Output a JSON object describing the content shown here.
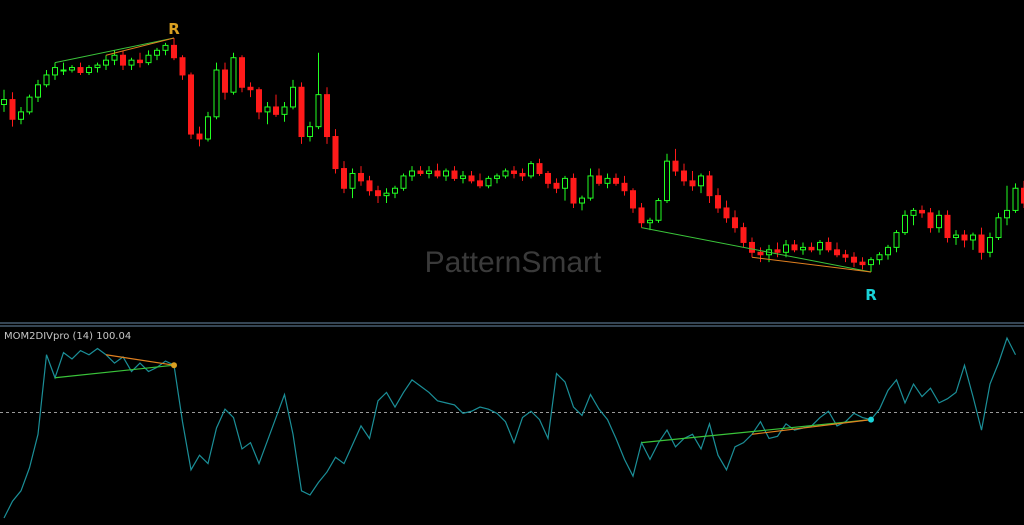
{
  "watermark": "PatternSmart",
  "indicator": {
    "name": "MOM2DIVpro (14) 100.04"
  },
  "markers": [
    {
      "label": "R",
      "color": "#d9a021"
    },
    {
      "label": "R",
      "color": "#19d3d8"
    }
  ],
  "colors": {
    "bull": "#22ff22",
    "bear": "#ff1a1a",
    "momentum": "#1b8f98",
    "divergence_green": "#3ac43a",
    "divergence_orange": "#e08020",
    "separator": "#6a8aa8",
    "zero_line": "#9a9a9a"
  },
  "chart_data": [
    {
      "type": "candlestick",
      "title": "",
      "series": [
        {
          "values": [
            [
              101.2,
              101.8,
              100.9,
              101.4
            ],
            [
              101.4,
              101.7,
              100.3,
              100.6
            ],
            [
              100.6,
              101.1,
              100.4,
              100.9
            ],
            [
              100.9,
              101.6,
              100.8,
              101.5
            ],
            [
              101.5,
              102.2,
              101.3,
              102.0
            ],
            [
              102.0,
              102.6,
              101.9,
              102.4
            ],
            [
              102.4,
              102.9,
              102.2,
              102.7
            ],
            [
              102.6,
              102.9,
              102.4,
              102.6
            ],
            [
              102.6,
              102.8,
              102.5,
              102.7
            ],
            [
              102.7,
              102.9,
              102.4,
              102.5
            ],
            [
              102.5,
              102.8,
              102.4,
              102.7
            ],
            [
              102.7,
              102.9,
              102.5,
              102.8
            ],
            [
              102.8,
              103.2,
              102.6,
              103.0
            ],
            [
              103.0,
              103.4,
              102.8,
              103.2
            ],
            [
              103.2,
              103.4,
              102.6,
              102.8
            ],
            [
              102.8,
              103.1,
              102.6,
              103.0
            ],
            [
              103.0,
              103.3,
              102.7,
              102.9
            ],
            [
              102.9,
              103.4,
              102.8,
              103.2
            ],
            [
              103.2,
              103.5,
              103.0,
              103.4
            ],
            [
              103.4,
              103.7,
              103.2,
              103.6
            ],
            [
              103.6,
              103.9,
              103.0,
              103.1
            ],
            [
              103.1,
              103.2,
              102.2,
              102.4
            ],
            [
              102.4,
              102.5,
              99.8,
              100.0
            ],
            [
              100.0,
              100.3,
              99.5,
              99.8
            ],
            [
              99.8,
              100.9,
              99.7,
              100.7
            ],
            [
              100.7,
              102.9,
              100.6,
              102.6
            ],
            [
              102.6,
              102.9,
              101.4,
              101.7
            ],
            [
              101.7,
              103.3,
              101.6,
              103.1
            ],
            [
              103.1,
              103.2,
              101.7,
              101.9
            ],
            [
              101.9,
              102.1,
              101.5,
              101.8
            ],
            [
              101.8,
              101.9,
              100.6,
              100.9
            ],
            [
              100.9,
              101.3,
              100.4,
              101.1
            ],
            [
              101.1,
              101.6,
              100.7,
              100.8
            ],
            [
              100.8,
              101.3,
              100.5,
              101.1
            ],
            [
              101.1,
              102.2,
              101.0,
              101.9
            ],
            [
              101.9,
              102.1,
              99.6,
              99.9
            ],
            [
              99.9,
              100.5,
              99.7,
              100.3
            ],
            [
              100.3,
              103.3,
              100.2,
              101.6
            ],
            [
              101.6,
              101.9,
              99.6,
              99.9
            ],
            [
              99.9,
              100.2,
              98.4,
              98.6
            ],
            [
              98.6,
              98.9,
              97.6,
              97.8
            ],
            [
              97.8,
              98.6,
              97.4,
              98.4
            ],
            [
              98.4,
              98.7,
              97.9,
              98.1
            ],
            [
              98.1,
              98.3,
              97.5,
              97.7
            ],
            [
              97.7,
              97.9,
              97.2,
              97.5
            ],
            [
              97.5,
              97.8,
              97.2,
              97.6
            ],
            [
              97.6,
              97.9,
              97.4,
              97.8
            ],
            [
              97.8,
              98.4,
              97.7,
              98.3
            ],
            [
              98.3,
              98.7,
              98.1,
              98.5
            ],
            [
              98.5,
              98.7,
              98.3,
              98.4
            ],
            [
              98.4,
              98.7,
              98.2,
              98.5
            ],
            [
              98.5,
              98.8,
              98.2,
              98.3
            ],
            [
              98.3,
              98.6,
              98.1,
              98.5
            ],
            [
              98.5,
              98.7,
              98.1,
              98.2
            ],
            [
              98.2,
              98.5,
              98.0,
              98.3
            ],
            [
              98.3,
              98.5,
              98.0,
              98.1
            ],
            [
              98.1,
              98.4,
              97.8,
              97.9
            ],
            [
              97.9,
              98.3,
              97.8,
              98.2
            ],
            [
              98.2,
              98.4,
              98.0,
              98.3
            ],
            [
              98.3,
              98.6,
              98.2,
              98.5
            ],
            [
              98.5,
              98.7,
              98.2,
              98.4
            ],
            [
              98.4,
              98.6,
              98.1,
              98.3
            ],
            [
              98.3,
              98.9,
              98.2,
              98.8
            ],
            [
              98.8,
              99.0,
              98.3,
              98.4
            ],
            [
              98.4,
              98.5,
              97.8,
              98.0
            ],
            [
              98.0,
              98.2,
              97.6,
              97.8
            ],
            [
              97.8,
              98.3,
              97.3,
              98.2
            ],
            [
              98.2,
              98.4,
              97.0,
              97.2
            ],
            [
              97.2,
              97.5,
              96.9,
              97.4
            ],
            [
              97.4,
              98.6,
              97.3,
              98.3
            ],
            [
              98.3,
              98.6,
              97.9,
              98.0
            ],
            [
              98.0,
              98.4,
              97.8,
              98.2
            ],
            [
              98.2,
              98.4,
              97.9,
              98.0
            ],
            [
              98.0,
              98.3,
              97.5,
              97.7
            ],
            [
              97.7,
              97.8,
              96.8,
              97.0
            ],
            [
              97.0,
              97.2,
              96.2,
              96.4
            ],
            [
              96.4,
              96.6,
              96.1,
              96.5
            ],
            [
              96.5,
              97.4,
              96.4,
              97.3
            ],
            [
              97.3,
              99.2,
              97.2,
              98.9
            ],
            [
              98.9,
              99.4,
              98.3,
              98.5
            ],
            [
              98.5,
              98.8,
              97.9,
              98.1
            ],
            [
              98.1,
              98.5,
              97.7,
              97.9
            ],
            [
              97.9,
              98.4,
              97.6,
              98.3
            ],
            [
              98.3,
              98.5,
              97.2,
              97.5
            ],
            [
              97.5,
              97.8,
              96.8,
              97.0
            ],
            [
              97.0,
              97.3,
              96.4,
              96.6
            ],
            [
              96.6,
              96.9,
              96.0,
              96.2
            ],
            [
              96.2,
              96.4,
              95.4,
              95.6
            ],
            [
              95.6,
              95.8,
              95.0,
              95.2
            ],
            [
              95.2,
              95.4,
              94.8,
              95.1
            ],
            [
              95.1,
              95.5,
              94.8,
              95.3
            ],
            [
              95.3,
              95.6,
              95.0,
              95.2
            ],
            [
              95.2,
              95.7,
              95.0,
              95.5
            ],
            [
              95.5,
              95.7,
              95.2,
              95.3
            ],
            [
              95.3,
              95.6,
              95.1,
              95.4
            ],
            [
              95.4,
              95.6,
              95.2,
              95.3
            ],
            [
              95.3,
              95.7,
              95.1,
              95.6
            ],
            [
              95.6,
              95.8,
              95.2,
              95.3
            ],
            [
              95.3,
              95.6,
              95.0,
              95.1
            ],
            [
              95.1,
              95.3,
              94.8,
              95.0
            ],
            [
              95.0,
              95.2,
              94.6,
              94.8
            ],
            [
              94.8,
              95.0,
              94.5,
              94.7
            ],
            [
              94.7,
              95.0,
              94.4,
              94.9
            ],
            [
              94.9,
              95.2,
              94.7,
              95.1
            ],
            [
              95.1,
              95.5,
              94.9,
              95.4
            ],
            [
              95.4,
              96.1,
              95.2,
              96.0
            ],
            [
              96.0,
              96.9,
              95.9,
              96.7
            ],
            [
              96.7,
              97.0,
              96.3,
              96.9
            ],
            [
              96.9,
              97.1,
              96.6,
              96.8
            ],
            [
              96.8,
              97.0,
              96.0,
              96.2
            ],
            [
              96.2,
              96.9,
              96.0,
              96.7
            ],
            [
              96.7,
              96.9,
              95.6,
              95.8
            ],
            [
              95.8,
              96.1,
              95.5,
              95.9
            ],
            [
              95.9,
              96.1,
              95.4,
              95.7
            ],
            [
              95.7,
              96.0,
              95.3,
              95.9
            ],
            [
              95.9,
              96.2,
              94.9,
              95.2
            ],
            [
              95.2,
              96.0,
              95.0,
              95.8
            ],
            [
              95.8,
              96.8,
              95.7,
              96.6
            ],
            [
              96.6,
              97.9,
              96.3,
              96.9
            ],
            [
              96.9,
              98.0,
              96.8,
              97.8
            ],
            [
              97.8,
              98.1,
              97.0,
              97.2
            ],
            [
              97.2,
              97.4,
              96.6,
              96.9
            ],
            [
              96.9,
              98.2,
              96.8,
              98.1
            ],
            [
              98.1,
              98.8,
              97.9,
              98.6
            ],
            [
              98.6,
              100.2,
              98.4,
              99.9
            ],
            [
              99.9,
              101.2,
              99.7,
              100.6
            ]
          ]
        }
      ],
      "markers": [
        {
          "index": 20,
          "label": "R",
          "color": "#d9a021",
          "position": "above"
        },
        {
          "index": 102,
          "label": "R",
          "color": "#19d3d8",
          "position": "below"
        }
      ],
      "divergence_lines": [
        {
          "from": 6,
          "to": 20,
          "color": "#3ac43a"
        },
        {
          "from": 12,
          "to": 20,
          "color": "#e08020"
        },
        {
          "from": 75,
          "to": 102,
          "color": "#3ac43a"
        },
        {
          "from": 88,
          "to": 102,
          "color": "#e08020"
        }
      ]
    },
    {
      "type": "line",
      "title": "MOM2DIVpro (14) 100.04",
      "reference_line": 100.04,
      "series": [
        {
          "name": "MOM2DIVpro (14)",
          "values": [
            95.0,
            95.8,
            96.3,
            97.4,
            99.0,
            102.8,
            101.7,
            102.9,
            102.6,
            103.0,
            102.8,
            103.1,
            102.8,
            102.4,
            102.7,
            102.0,
            102.4,
            102.0,
            102.2,
            102.5,
            102.3,
            99.6,
            97.3,
            98.0,
            97.6,
            99.3,
            100.2,
            99.8,
            98.3,
            98.6,
            97.6,
            98.7,
            99.8,
            100.9,
            99.0,
            96.3,
            96.1,
            96.7,
            97.2,
            97.9,
            97.6,
            98.5,
            99.4,
            98.8,
            100.6,
            101.0,
            100.3,
            101.0,
            101.6,
            101.3,
            101.0,
            100.6,
            100.5,
            100.4,
            100.0,
            100.1,
            100.3,
            100.2,
            100.0,
            99.6,
            98.6,
            99.8,
            100.1,
            99.7,
            98.8,
            101.9,
            101.5,
            100.3,
            99.9,
            100.9,
            100.2,
            99.7,
            98.8,
            97.8,
            97.0,
            98.6,
            97.8,
            98.6,
            99.2,
            98.4,
            98.8,
            99.0,
            98.3,
            99.5,
            98.0,
            97.3,
            98.4,
            98.6,
            99.0,
            99.6,
            98.8,
            98.9,
            99.5,
            99.2,
            99.3,
            99.4,
            99.8,
            100.1,
            99.4,
            99.6,
            100.0,
            99.8,
            99.7,
            100.2,
            101.1,
            101.6,
            100.5,
            101.4,
            100.8,
            101.2,
            100.5,
            100.7,
            101.0,
            102.3,
            100.8,
            99.2,
            101.4,
            102.4,
            103.6,
            102.8
          ]
        }
      ],
      "markers": [
        {
          "index": 20,
          "color": "#d9a021"
        },
        {
          "index": 102,
          "color": "#19d3d8"
        }
      ],
      "divergence_lines": [
        {
          "from": 6,
          "to": 20,
          "color": "#3ac43a"
        },
        {
          "from": 12,
          "to": 20,
          "color": "#e08020"
        },
        {
          "from": 75,
          "to": 102,
          "color": "#3ac43a"
        },
        {
          "from": 88,
          "to": 102,
          "color": "#e08020"
        }
      ]
    }
  ]
}
